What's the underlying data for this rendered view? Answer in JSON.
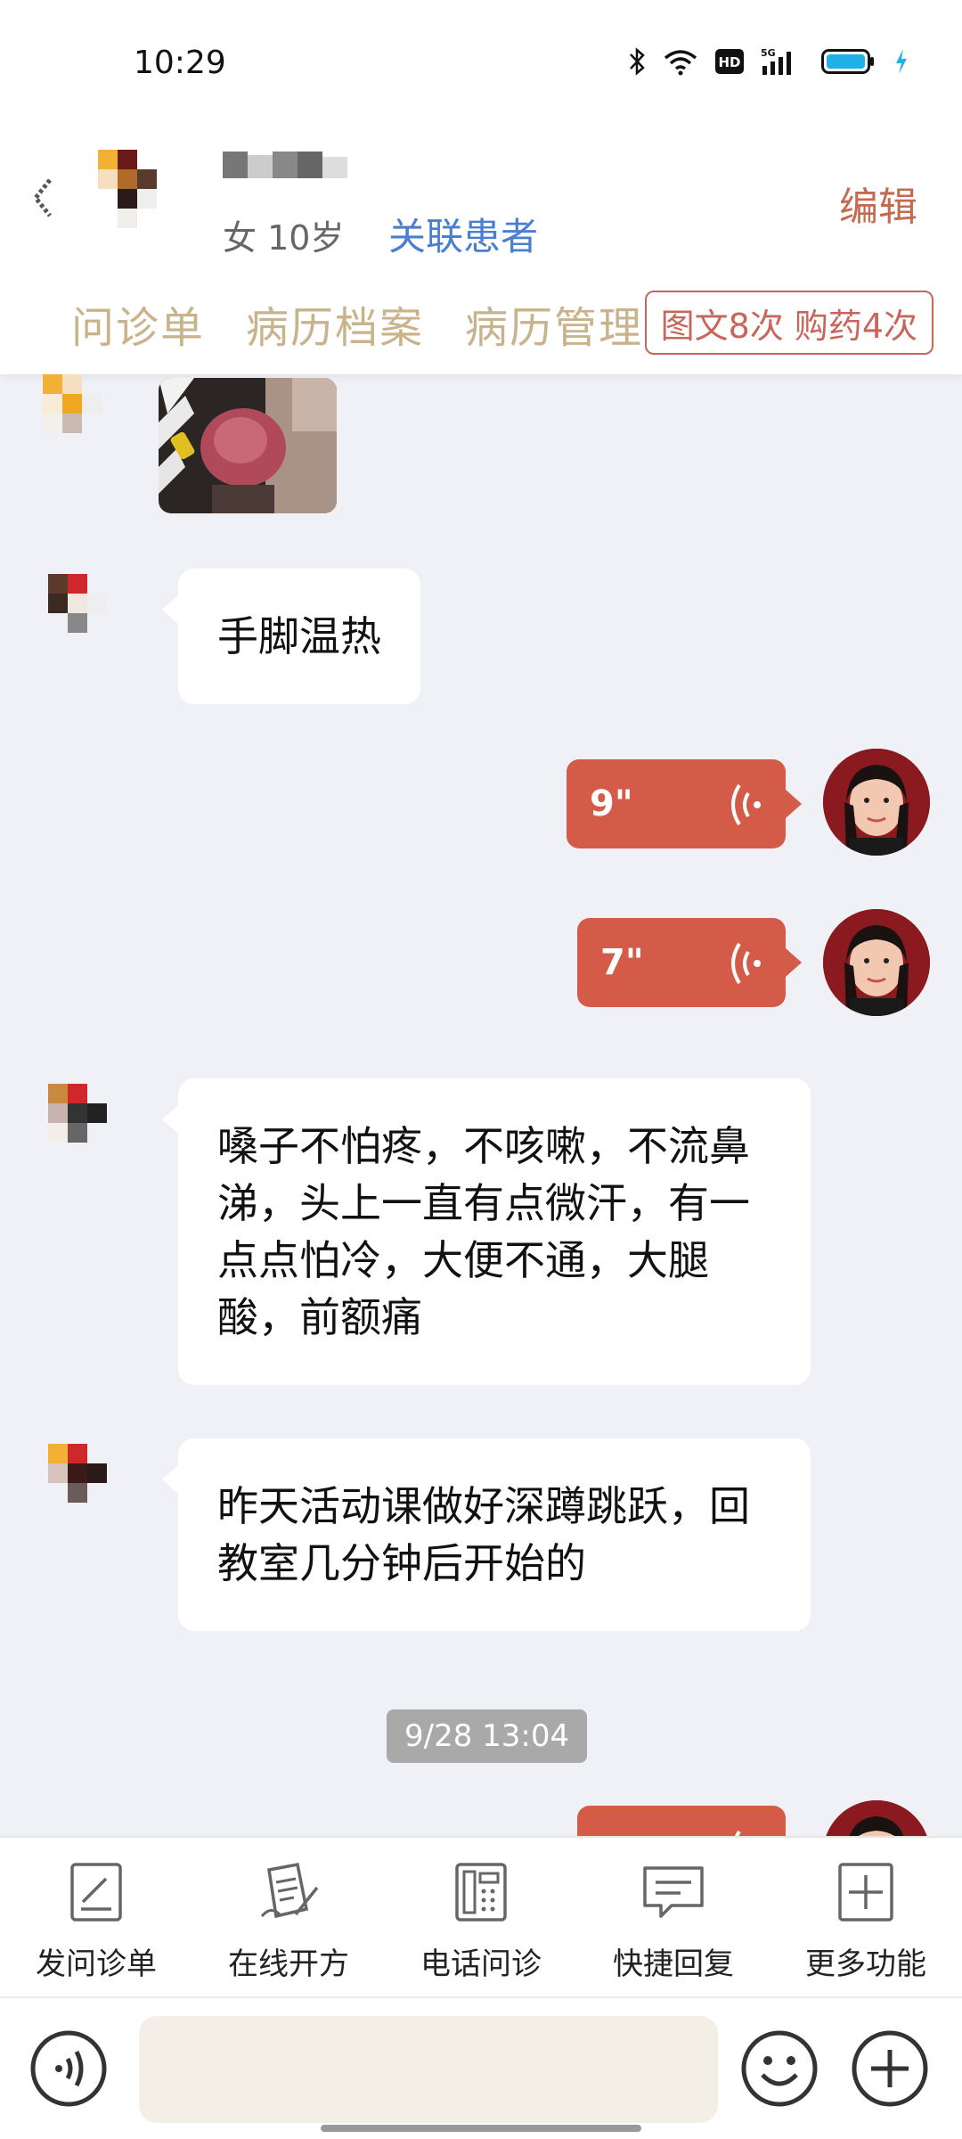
{
  "status": {
    "time": "10:29",
    "network": "5G",
    "hd_label": "HD"
  },
  "header": {
    "patient_info": "女 10岁",
    "link_patient": "关联患者",
    "edit": "编辑",
    "tabs": [
      {
        "label": "问诊单"
      },
      {
        "label": "病历档案"
      },
      {
        "label": "病历管理"
      }
    ],
    "counts_badge": "图文8次 购药4次"
  },
  "messages": [
    {
      "from": "patient",
      "type": "image"
    },
    {
      "from": "patient",
      "type": "text",
      "text": "手脚温热"
    },
    {
      "from": "doctor",
      "type": "voice",
      "duration": "9\""
    },
    {
      "from": "doctor",
      "type": "voice",
      "duration": "7\""
    },
    {
      "from": "patient",
      "type": "text",
      "text": "嗓子不怕疼，不咳嗽，不流鼻涕，头上一直有点微汗，有一点点怕冷，大便不通，大腿酸，前额痛"
    },
    {
      "from": "patient",
      "type": "text",
      "text": "昨天活动课做好深蹲跳跃，回教室几分钟后开始的"
    },
    {
      "from": "system",
      "type": "timestamp",
      "text": "9/28 13:04"
    },
    {
      "from": "doctor",
      "type": "voice",
      "duration": ""
    }
  ],
  "toolbar": {
    "items": [
      {
        "label": "发问诊单",
        "icon": "form-icon"
      },
      {
        "label": "在线开方",
        "icon": "prescription-icon"
      },
      {
        "label": "电话问诊",
        "icon": "phone-icon"
      },
      {
        "label": "快捷回复",
        "icon": "quick-reply-icon"
      },
      {
        "label": "更多功能",
        "icon": "more-icon"
      }
    ]
  },
  "input": {
    "placeholder": ""
  },
  "colors": {
    "accent": "#d35b47",
    "link": "#4a7fd0",
    "tab": "#c9b38c",
    "background": "#f0f1f6"
  }
}
